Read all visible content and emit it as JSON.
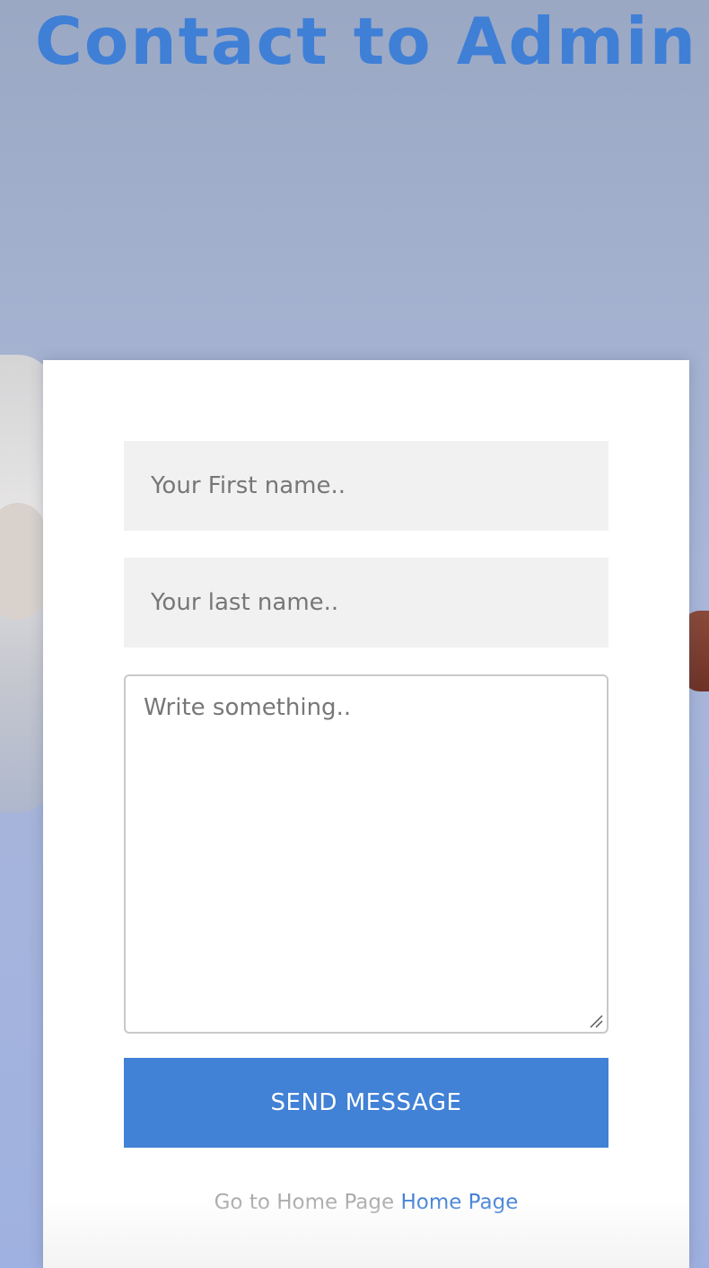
{
  "page": {
    "title": "Contact to Admin"
  },
  "form": {
    "first_name": {
      "placeholder": "Your First name..",
      "value": ""
    },
    "last_name": {
      "placeholder": "Your last name..",
      "value": ""
    },
    "message": {
      "placeholder": "Write something..",
      "value": ""
    },
    "submit_label": "SEND MESSAGE"
  },
  "footer": {
    "text": "Go to Home Page",
    "link_label": "Home Page"
  },
  "colors": {
    "accent": "#4181d6",
    "title": "#3f7fd6",
    "input_bg": "#f1f1f1",
    "footer_text": "#a9a9a9"
  }
}
